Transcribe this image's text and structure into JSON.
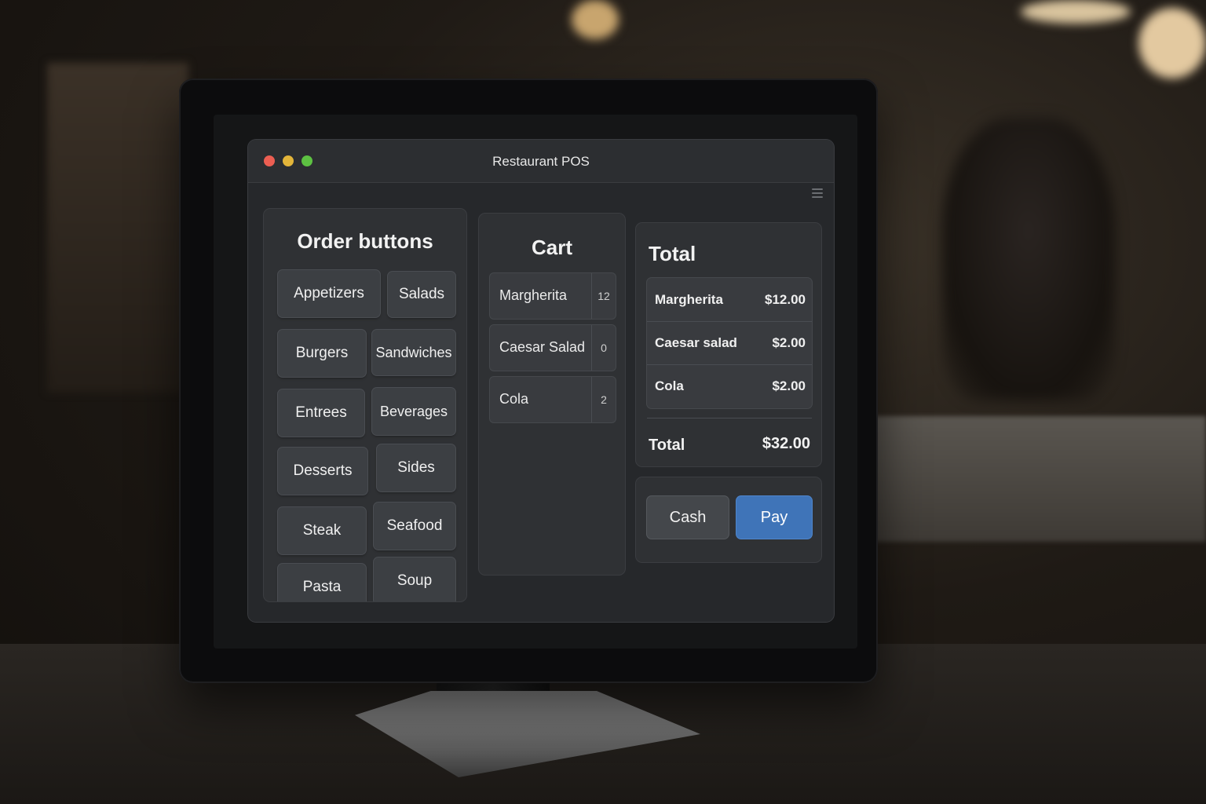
{
  "window": {
    "title": "Restaurant POS"
  },
  "order_panel": {
    "title": "Order buttons",
    "buttons": [
      "Appetizers",
      "Salads",
      "Burgers",
      "Sandwiches",
      "Entrees",
      "Beverages",
      "Desserts",
      "Sides",
      "Steak",
      "Seafood",
      "Pasta",
      "Soup"
    ]
  },
  "cart": {
    "title": "Cart",
    "items": [
      {
        "name": "Margherita",
        "qty": "12"
      },
      {
        "name": "Caesar Salad",
        "qty": "0"
      },
      {
        "name": "Cola",
        "qty": "2"
      }
    ]
  },
  "total": {
    "title": "Total",
    "items": [
      {
        "name": "Margherita",
        "price": "$12.00"
      },
      {
        "name": "Caesar salad",
        "price": "$2.00"
      },
      {
        "name": "Cola",
        "price": "$2.00"
      }
    ],
    "grand_label": "Total",
    "grand_value": "$32.00"
  },
  "payment": {
    "cash_label": "Cash",
    "pay_label": "Pay"
  },
  "colors": {
    "accent": "#3f74b8",
    "close": "#ec5e52",
    "minimize": "#e3b53a",
    "maximize": "#5dc142"
  },
  "icons": {
    "menu": "hamburger-menu-icon"
  }
}
